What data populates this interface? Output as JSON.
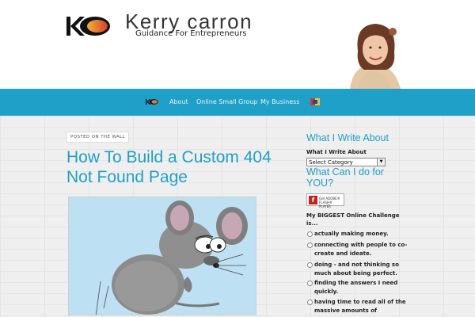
{
  "header": {
    "brand_name": "Kerry carron",
    "tagline": "Guidance For Entrepreneurs"
  },
  "nav": {
    "items": [
      {
        "label": "About"
      },
      {
        "label": "Online Small Group"
      },
      {
        "label": "My Business"
      }
    ]
  },
  "post": {
    "tag": "POSTED ON THE WALL",
    "title": "How To Build a Custom 404 Not Found Page"
  },
  "sidebar": {
    "heading_write": "What I Write About",
    "widget_label": "What I Write About",
    "category_select": "Select Category",
    "heading_do": "What Can I do for YOU?",
    "flash_badge": "Get ADOBE® FLASH® PLAYER",
    "poll_question": "My BIGGEST Online Challenge is...",
    "poll_options": [
      "actually making money.",
      "connecting with people to co-create and ideate.",
      "doing - and not thinking so much about being perfect.",
      "finding the answers I need quickly.",
      "having time to read all of the massive amounts of"
    ]
  },
  "colors": {
    "accent": "#1ea0c8",
    "text": "#222222",
    "background": "#efefef"
  }
}
